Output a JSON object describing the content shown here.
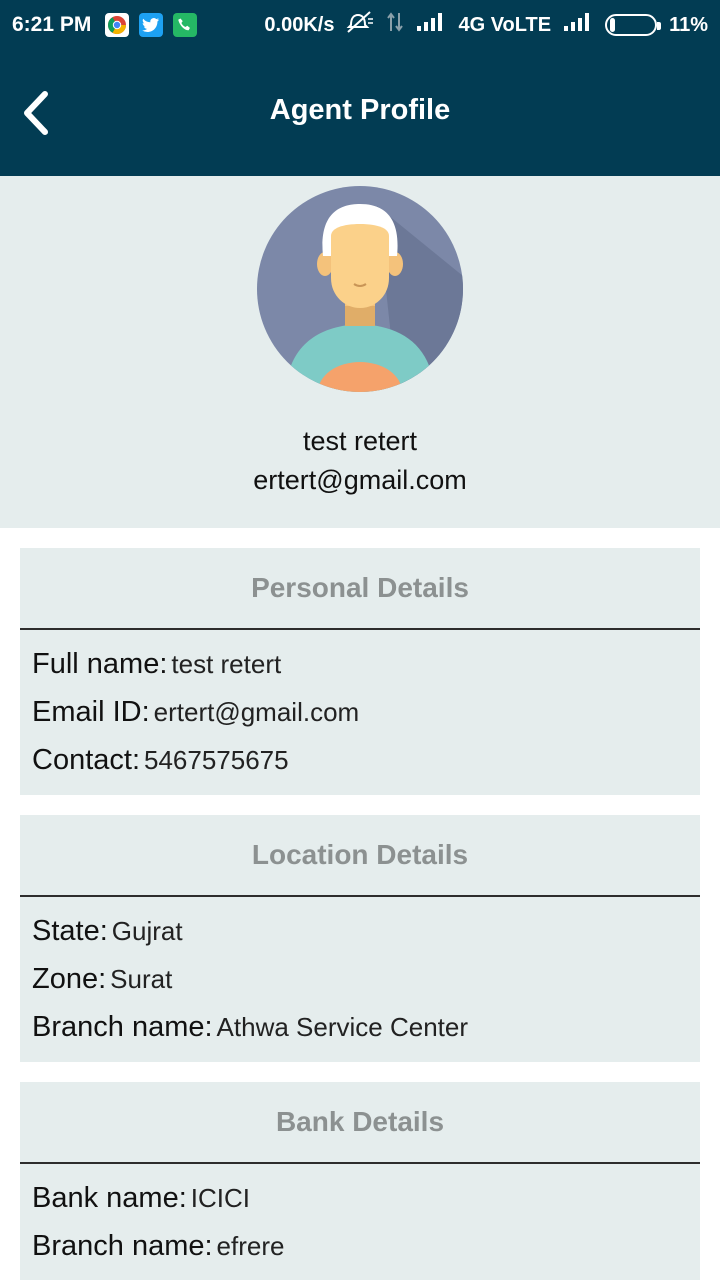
{
  "status_bar": {
    "time": "6:21 PM",
    "net_speed": "0.00K/s",
    "network": "4G VoLTE",
    "battery": "11%",
    "battery_level": 0.11
  },
  "app_bar": {
    "title": "Agent Profile",
    "back_icon": "chevron-left-icon"
  },
  "profile": {
    "name": "test retert",
    "email": "ertert@gmail.com",
    "avatar_icon": "user-avatar-icon"
  },
  "sections": {
    "personal": {
      "title": "Personal Details",
      "rows": [
        {
          "label": "Full name:",
          "value": "test retert"
        },
        {
          "label": "Email ID:",
          "value": "ertert@gmail.com"
        },
        {
          "label": "Contact:",
          "value": "5467575675"
        }
      ]
    },
    "location": {
      "title": "Location Details",
      "rows": [
        {
          "label": "State:",
          "value": "Gujrat"
        },
        {
          "label": "Zone:",
          "value": "Surat"
        },
        {
          "label": "Branch name:",
          "value": "Athwa Service Center"
        }
      ]
    },
    "bank": {
      "title": "Bank Details",
      "rows": [
        {
          "label": "Bank name:",
          "value": "ICICI"
        },
        {
          "label": "Branch name:",
          "value": "efrere"
        }
      ]
    }
  },
  "colors": {
    "app_bar": "#023c53",
    "panel": "#e5eded",
    "section_title": "#8c9191"
  }
}
